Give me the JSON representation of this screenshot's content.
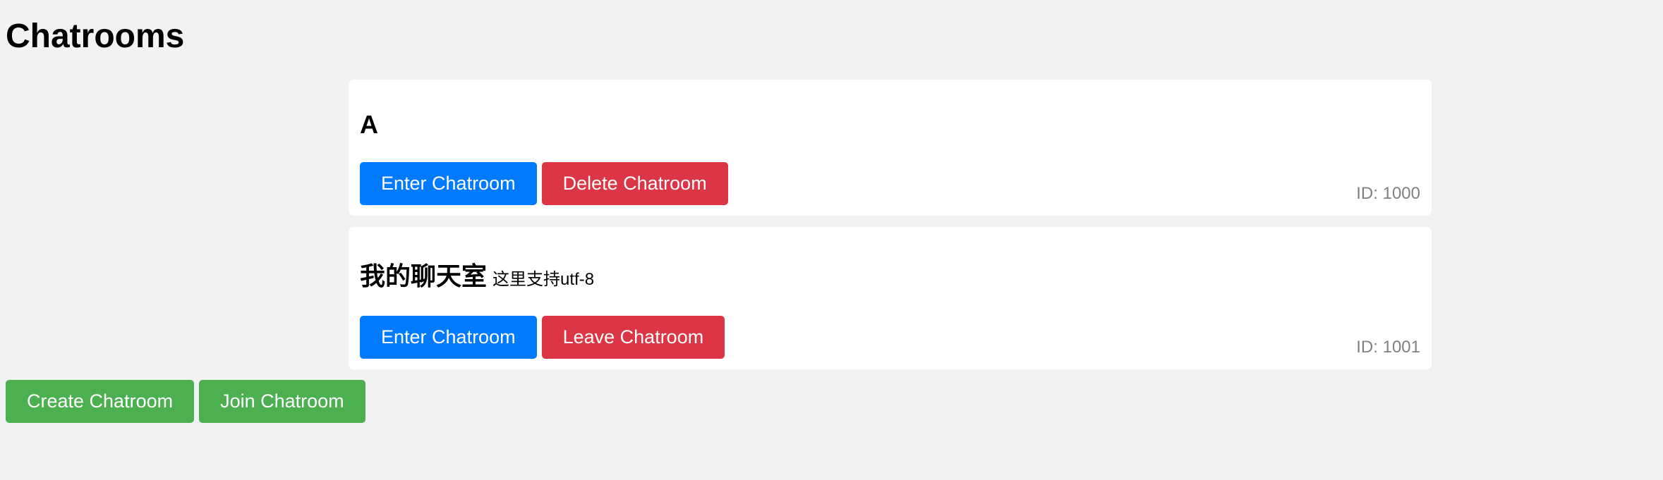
{
  "page": {
    "title": "Chatrooms"
  },
  "colors": {
    "background": "#f2f2f2",
    "card": "#ffffff",
    "primary": "#007bff",
    "danger": "#dc3545",
    "success": "#4caf50",
    "muted": "#808080"
  },
  "chatrooms": [
    {
      "name": "A",
      "description": "",
      "enter_label": "Enter Chatroom",
      "secondary_label": "Delete Chatroom",
      "id_text": "ID: 1000"
    },
    {
      "name": "我的聊天室",
      "description": "这里支持utf-8",
      "enter_label": "Enter Chatroom",
      "secondary_label": "Leave Chatroom",
      "id_text": "ID: 1001"
    }
  ],
  "actions": {
    "create_label": "Create Chatroom",
    "join_label": "Join Chatroom"
  }
}
